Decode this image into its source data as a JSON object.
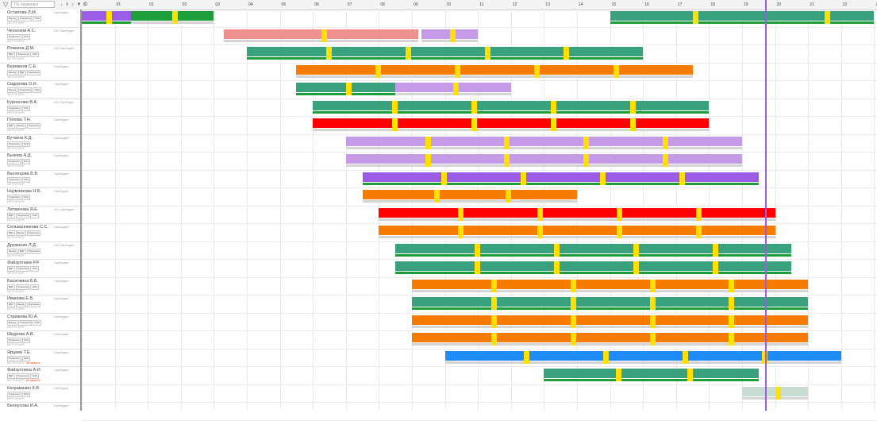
{
  "toolbar": {
    "filter_icon": "filter-icon",
    "search_placeholder": "По названию",
    "tools_text": "↓ ≡ ↕ ▼ D"
  },
  "timeline": {
    "hours": [
      "0",
      "01",
      "01",
      "02",
      "03",
      "04",
      "05",
      "06",
      "07",
      "08",
      "09",
      "10",
      "11",
      "12",
      "13",
      "14",
      "15",
      "16",
      "17",
      "18",
      "19",
      "20",
      "21",
      "22",
      "23"
    ]
  },
  "colors": {
    "purple": "#9b5de5",
    "green": "#3aa17e",
    "darkgreen": "#1e9e3b",
    "pink": "#f08f8f",
    "lavender": "#c59be8",
    "orange": "#f57c00",
    "red": "#ff0000",
    "blue": "#1e8cff",
    "yellow": "#ffe000",
    "gray": "#d4d4d4",
    "mint": "#c8ddd2"
  },
  "employees": [
    {
      "name": "Остапова Л.М.",
      "status": "Свободен",
      "tags": [
        "Выезд",
        "Подписан",
        "Табл"
      ],
      "code": "МЕТРОПАРК"
    },
    {
      "name": "Чесноков А.С.",
      "status": "НО Свободен",
      "tags": [
        "Подписан",
        "Табл"
      ],
      "code": "МЕТРОПАРК"
    },
    {
      "name": "Рожкина Д.М.",
      "status": "НО Свободен",
      "tags": [
        "ВДТ",
        "Подписан",
        "Табл"
      ],
      "code": "МЕТРОПАРК"
    },
    {
      "name": "Бережнов С.Е.",
      "status": "Свободен",
      "tags": [
        "Выезд",
        "ВДТ",
        "Подписан"
      ],
      "code": "МЕТРОПАРК"
    },
    {
      "name": "Сидорова О.Н.",
      "status": "Свободен",
      "tags": [
        "Выезд",
        "Подписан",
        "Табл"
      ],
      "code": "МЕТРОПАРК"
    },
    {
      "name": "Курносова В.А.",
      "status": "НО Свободен",
      "tags": [
        "Подписан",
        "Табл"
      ],
      "code": "МЕТРОПАРК"
    },
    {
      "name": "Попова Т.Н.",
      "status": "Свободен",
      "tags": [
        "ВДТ",
        "Выезд",
        "Подписан"
      ],
      "code": "МЕТРОПАРК"
    },
    {
      "name": "Буткина К.Д.",
      "status": "Свободен",
      "tags": [
        "Подписан",
        "Табл"
      ],
      "code": "МЕТРОПАРК"
    },
    {
      "name": "Быкова А.Д.",
      "status": "Свободен",
      "tags": [
        "Подписан",
        "Табл"
      ],
      "code": "МЕТРОПАРК"
    },
    {
      "name": "Васнецова В.В.",
      "status": "Свободен",
      "tags": [
        "Подписан",
        "Табл"
      ],
      "code": "МЕТРОПАРК"
    },
    {
      "name": "Наумчикова Н.В.",
      "status": "Свободен",
      "tags": [
        "Подписан",
        "Табл"
      ],
      "code": "МЕТРОПАРК"
    },
    {
      "name": "Литвинова Я.Е.",
      "status": "НО Свободен",
      "tags": [
        "ВДТ",
        "Подписан",
        "Табл"
      ],
      "code": "МЕТРОПАРК"
    },
    {
      "name": "Сельванникова С.С.",
      "status": "Свободен",
      "tags": [
        "ВДТ",
        "Выезд",
        "Подписан"
      ],
      "code": "МЕТРОПАРК"
    },
    {
      "name": "Дружинин Л.Д.",
      "status": "НО Свободен",
      "tags": [
        "Выезд",
        "ВДТ",
        "Подписан"
      ],
      "code": "МЕТРОПАРК"
    },
    {
      "name": "Файзуллаев Р.Р.",
      "status": "Свободен",
      "tags": [
        "ВДТ",
        "Подписан",
        "Табл"
      ],
      "code": "МЕТРОПАРК"
    },
    {
      "name": "Басилкина Б.Б.",
      "status": "Свободен",
      "tags": [
        "ВДТ",
        "Подписан",
        "Табл"
      ],
      "code": "МЕТРОПАРК"
    },
    {
      "name": "Иванова Е.Б.",
      "status": "Свободен",
      "tags": [
        "ВДТ",
        "Выезд",
        "Подписан"
      ],
      "code": "МЕТРОПАРК"
    },
    {
      "name": "Стрижова Ю.А.",
      "status": "Свободен",
      "tags": [
        "Выезд",
        "Подписан",
        "Табл"
      ],
      "code": "МЕТРОПАРК"
    },
    {
      "name": "Шкурова А.В.",
      "status": "Свободен",
      "tags": [
        "Подписан",
        "Табл"
      ],
      "code": "МЕТРОПАРК"
    },
    {
      "name": "Ярцева Т.Е.",
      "status": "Свободен",
      "tags": [
        "Подписан",
        "Табл"
      ],
      "code": "МЕТРОПАРК",
      "note": "Не звонить"
    },
    {
      "name": "Файзуллина А.И.",
      "status": "Свободен",
      "tags": [
        "ВДТ",
        "Подписан",
        "Табл"
      ],
      "code": "МЕТРОПАРК",
      "note": "Не звонить"
    },
    {
      "name": "Катрамакин К.В.",
      "status": "Свободен",
      "tags": [
        "Подписан",
        "Табл"
      ],
      "code": "МЕТРОПАРК"
    },
    {
      "name": "Белоусова И.А.",
      "status": "Свободен",
      "tags": [],
      "code": ""
    }
  ]
}
